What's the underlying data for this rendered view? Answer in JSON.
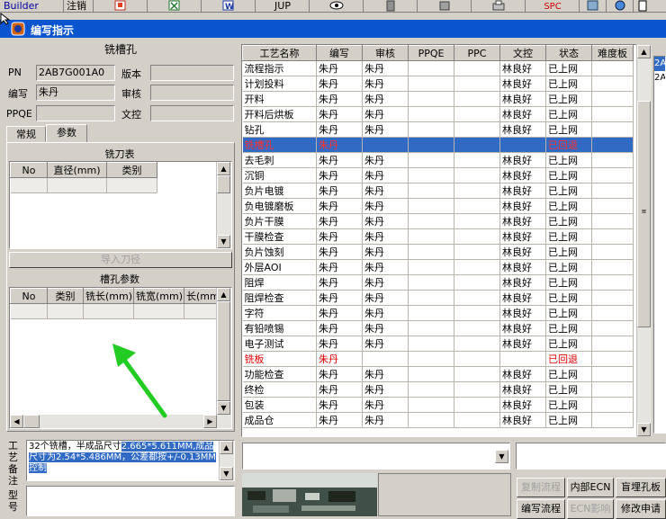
{
  "app": {
    "menu_builder": "Builder",
    "menu_logout": "注销",
    "toolbar_jup": "JUP",
    "toolbar_spc": "SPC"
  },
  "window": {
    "title": "编写指示"
  },
  "left": {
    "section_title": "铣槽孔",
    "pn_label": "PN",
    "pn_value": "2AB7G001A0",
    "version_label": "版本",
    "version_value": "",
    "writer_label": "编写",
    "writer_value": "朱丹",
    "reviewer_label": "审核",
    "reviewer_value": "",
    "ppqe_label": "PPQE",
    "ppqe_value": "",
    "doc_label": "文控",
    "doc_value": "",
    "tabs": [
      "常规",
      "参数"
    ],
    "cutter_table_title": "铣刀表",
    "cutter_columns": [
      "No",
      "直径(mm)",
      "类别"
    ],
    "import_button": "导入刀径",
    "slot_params_title": "槽孔参数",
    "slot_columns": [
      "No",
      "类别",
      "铣长(mm)",
      "铣宽(mm)",
      "长(mm"
    ],
    "remark_label": "工艺备注",
    "remark_text_plain": "32个铣槽，半成品尺寸",
    "remark_text_selected": "2.665*5.611MM,成品尺寸为2.54*5.486MM，公差都按+/-0.13MM控制",
    "model_label": "型号"
  },
  "process_table": {
    "columns": [
      "工艺名称",
      "编写",
      "审核",
      "PPQE",
      "PPC",
      "文控",
      "状态",
      "难度板"
    ],
    "rows": [
      {
        "name": "流程指示",
        "writer": "朱丹",
        "reviewer": "朱丹",
        "ppqe": "",
        "ppc": "",
        "doc": "林良好",
        "status": "已上网",
        "hl": false,
        "red": false
      },
      {
        "name": "计划投料",
        "writer": "朱丹",
        "reviewer": "朱丹",
        "ppqe": "",
        "ppc": "",
        "doc": "林良好",
        "status": "已上网",
        "hl": false,
        "red": false
      },
      {
        "name": "开料",
        "writer": "朱丹",
        "reviewer": "朱丹",
        "ppqe": "",
        "ppc": "",
        "doc": "林良好",
        "status": "已上网",
        "hl": false,
        "red": false
      },
      {
        "name": "开料后烘板",
        "writer": "朱丹",
        "reviewer": "朱丹",
        "ppqe": "",
        "ppc": "",
        "doc": "林良好",
        "status": "已上网",
        "hl": false,
        "red": false
      },
      {
        "name": "钻孔",
        "writer": "朱丹",
        "reviewer": "朱丹",
        "ppqe": "",
        "ppc": "",
        "doc": "林良好",
        "status": "已上网",
        "hl": false,
        "red": false
      },
      {
        "name": "铣槽孔",
        "writer": "朱丹",
        "reviewer": "",
        "ppqe": "",
        "ppc": "",
        "doc": "",
        "status": "已回退",
        "hl": true,
        "red": true
      },
      {
        "name": "去毛刺",
        "writer": "朱丹",
        "reviewer": "朱丹",
        "ppqe": "",
        "ppc": "",
        "doc": "林良好",
        "status": "已上网",
        "hl": false,
        "red": false
      },
      {
        "name": "沉铜",
        "writer": "朱丹",
        "reviewer": "朱丹",
        "ppqe": "",
        "ppc": "",
        "doc": "林良好",
        "status": "已上网",
        "hl": false,
        "red": false
      },
      {
        "name": "负片电镀",
        "writer": "朱丹",
        "reviewer": "朱丹",
        "ppqe": "",
        "ppc": "",
        "doc": "林良好",
        "status": "已上网",
        "hl": false,
        "red": false
      },
      {
        "name": "负电镀磨板",
        "writer": "朱丹",
        "reviewer": "朱丹",
        "ppqe": "",
        "ppc": "",
        "doc": "林良好",
        "status": "已上网",
        "hl": false,
        "red": false
      },
      {
        "name": "负片干膜",
        "writer": "朱丹",
        "reviewer": "朱丹",
        "ppqe": "",
        "ppc": "",
        "doc": "林良好",
        "status": "已上网",
        "hl": false,
        "red": false
      },
      {
        "name": "干膜检查",
        "writer": "朱丹",
        "reviewer": "朱丹",
        "ppqe": "",
        "ppc": "",
        "doc": "林良好",
        "status": "已上网",
        "hl": false,
        "red": false
      },
      {
        "name": "负片蚀刻",
        "writer": "朱丹",
        "reviewer": "朱丹",
        "ppqe": "",
        "ppc": "",
        "doc": "林良好",
        "status": "已上网",
        "hl": false,
        "red": false
      },
      {
        "name": "外层AOI",
        "writer": "朱丹",
        "reviewer": "朱丹",
        "ppqe": "",
        "ppc": "",
        "doc": "林良好",
        "status": "已上网",
        "hl": false,
        "red": false
      },
      {
        "name": "阻焊",
        "writer": "朱丹",
        "reviewer": "朱丹",
        "ppqe": "",
        "ppc": "",
        "doc": "林良好",
        "status": "已上网",
        "hl": false,
        "red": false
      },
      {
        "name": "阻焊检查",
        "writer": "朱丹",
        "reviewer": "朱丹",
        "ppqe": "",
        "ppc": "",
        "doc": "林良好",
        "status": "已上网",
        "hl": false,
        "red": false
      },
      {
        "name": "字符",
        "writer": "朱丹",
        "reviewer": "朱丹",
        "ppqe": "",
        "ppc": "",
        "doc": "林良好",
        "status": "已上网",
        "hl": false,
        "red": false
      },
      {
        "name": "有铅喷锡",
        "writer": "朱丹",
        "reviewer": "朱丹",
        "ppqe": "",
        "ppc": "",
        "doc": "林良好",
        "status": "已上网",
        "hl": false,
        "red": false
      },
      {
        "name": "电子测试",
        "writer": "朱丹",
        "reviewer": "朱丹",
        "ppqe": "",
        "ppc": "",
        "doc": "林良好",
        "status": "已上网",
        "hl": false,
        "red": false
      },
      {
        "name": "铣板",
        "writer": "朱丹",
        "reviewer": "",
        "ppqe": "",
        "ppc": "",
        "doc": "",
        "status": "已回退",
        "hl": false,
        "red": true
      },
      {
        "name": "功能检查",
        "writer": "朱丹",
        "reviewer": "朱丹",
        "ppqe": "",
        "ppc": "",
        "doc": "林良好",
        "status": "已上网",
        "hl": false,
        "red": false
      },
      {
        "name": "终检",
        "writer": "朱丹",
        "reviewer": "朱丹",
        "ppqe": "",
        "ppc": "",
        "doc": "林良好",
        "status": "已上网",
        "hl": false,
        "red": false
      },
      {
        "name": "包装",
        "writer": "朱丹",
        "reviewer": "朱丹",
        "ppqe": "",
        "ppc": "",
        "doc": "林良好",
        "status": "已上网",
        "hl": false,
        "red": false
      },
      {
        "name": "成品仓",
        "writer": "朱丹",
        "reviewer": "朱丹",
        "ppqe": "",
        "ppc": "",
        "doc": "林良好",
        "status": "已上网",
        "hl": false,
        "red": false
      }
    ]
  },
  "right_list": {
    "items": [
      "2A",
      "2A"
    ]
  },
  "bottom_buttons": {
    "copy_flow": "复制流程",
    "internal_ecn": "内部ECN",
    "blind_hole": "盲埋孔板",
    "write_flow": "编写流程",
    "ecn_effect": "ECN影响",
    "modify_request": "修改申请"
  },
  "colors": {
    "title_bar": "#0a54d0",
    "selection": "#316ac5",
    "returned_status": "#e00000",
    "arrow": "#22cc22"
  }
}
